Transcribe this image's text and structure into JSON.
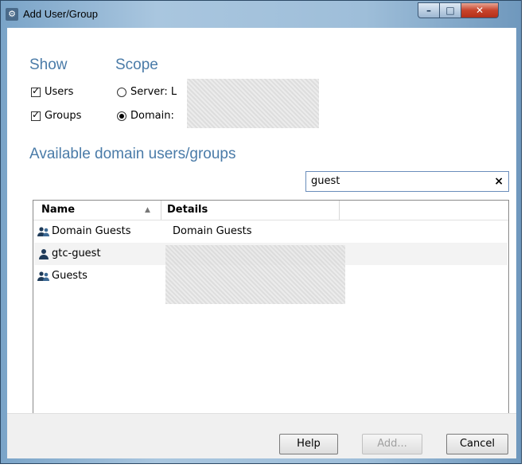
{
  "window": {
    "title": "Add User/Group"
  },
  "show": {
    "heading": "Show",
    "users_label": "Users",
    "groups_label": "Groups",
    "users_checked": true,
    "groups_checked": true
  },
  "scope": {
    "heading": "Scope",
    "server_label": "Server: L",
    "domain_label": "Domain:",
    "selected": "domain"
  },
  "section_title": "Available domain users/groups",
  "search": {
    "value": "guest",
    "clear_glyph": "×"
  },
  "table": {
    "columns": [
      "Name",
      "Details"
    ],
    "sort_indicator": "▲",
    "rows": [
      {
        "icon": "group-icon",
        "name": "Domain Guests",
        "details": "Domain Guests"
      },
      {
        "icon": "user-icon",
        "name": "gtc-guest",
        "details": ""
      },
      {
        "icon": "group-icon",
        "name": "Guests",
        "details": ""
      }
    ]
  },
  "buttons": {
    "help": "Help",
    "add": "Add...",
    "cancel": "Cancel"
  },
  "colors": {
    "heading": "#4a7ba8",
    "accent_border": "#6a8dbb"
  }
}
